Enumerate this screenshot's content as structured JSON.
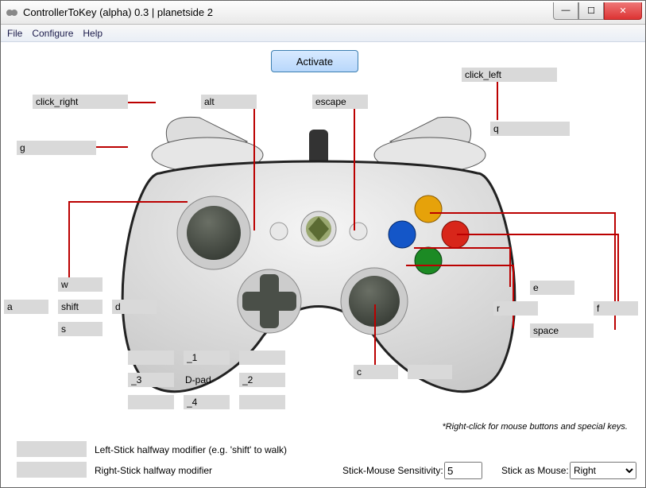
{
  "window": {
    "title": "ControllerToKey (alpha) 0.3 | planetside 2",
    "menu": {
      "file": "File",
      "configure": "Configure",
      "help": "Help"
    }
  },
  "activate_label": "Activate",
  "bindings": {
    "click_right": "click_right",
    "alt": "alt",
    "escape": "escape",
    "click_left": "click_left",
    "g": "g",
    "q": "q",
    "w": "w",
    "a": "a",
    "shift": "shift",
    "d": "d",
    "s": "s",
    "dp_1": "_1",
    "dp_2": "_2",
    "dp_3": "_3",
    "dp_4": "_4",
    "dpad_label": "D-pad",
    "c": "c",
    "e": "e",
    "r": "r",
    "f": "f",
    "space": "space"
  },
  "footer": {
    "left_mod_label": "Left-Stick halfway modifier (e.g. 'shift' to walk)",
    "right_mod_label": "Right-Stick halfway modifier",
    "sens_label": "Stick-Mouse Sensitivity:",
    "sens_value": "5",
    "stick_as_mouse_label": "Stick as Mouse:",
    "stick_as_mouse_value": "Right",
    "hint": "*Right-click for mouse buttons and special keys."
  }
}
